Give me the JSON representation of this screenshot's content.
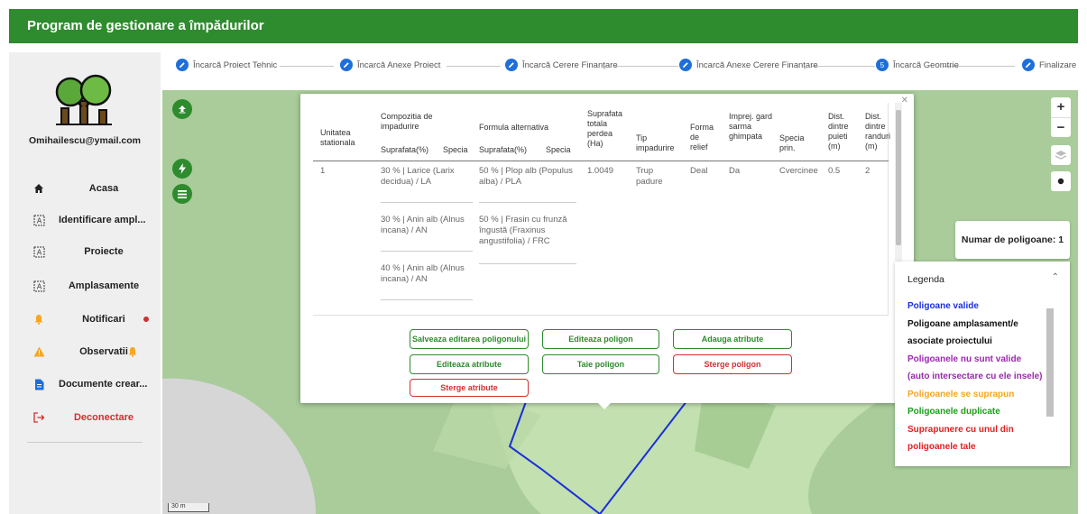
{
  "app": {
    "title": "Program de gestionare a împădurilor"
  },
  "colors": {
    "brand": "#2e8b2e",
    "step_dot": "#1e6fd9",
    "danger": "#d32f2f",
    "polygon_line": "#1a2fd8"
  },
  "sidebar": {
    "email": "Omihailescu@ymail.com",
    "items": [
      {
        "label": "Acasa",
        "icon": "home-icon"
      },
      {
        "label": "Identificare ampl...",
        "icon": "map-select-icon"
      },
      {
        "label": "Proiecte",
        "icon": "map-select-icon"
      },
      {
        "label": "Amplasamente",
        "icon": "map-select-icon"
      },
      {
        "label": "Notificari",
        "icon": "bell-icon"
      },
      {
        "label": "Observatii",
        "icon": "warning-icon"
      },
      {
        "label": "Documente crear...",
        "icon": "document-icon"
      },
      {
        "label": "Deconectare",
        "icon": "logout-icon"
      }
    ]
  },
  "stepper": {
    "steps": [
      {
        "label": "Încarcă Proiect Tehnic",
        "marker": ""
      },
      {
        "label": "Încarcă Anexe Proiect",
        "marker": ""
      },
      {
        "label": "Încarcă Cerere Finanțare",
        "marker": ""
      },
      {
        "label": "Încarcă Anexe Cerere Finanțare",
        "marker": ""
      },
      {
        "label": "Încarcă Geomtrie",
        "marker": "5"
      },
      {
        "label": "Finalizare",
        "marker": ""
      }
    ]
  },
  "table": {
    "headers": {
      "unitatea": "Unitatea stationala",
      "compozitia": "Compozitia de impadurire",
      "formula": "Formula alternativa",
      "suprafata_pct": "Suprafata(%)",
      "specia": "Specia",
      "suprafata_totala": "Suprafata totala perdea (Ha)",
      "tip": "Tip impadurire",
      "forma": "Forma de relief",
      "imprej": "Imprej. gard sarma ghimpata",
      "specia_prin": "Specia prin.",
      "dist_puieti": "Dist. dintre puieti (m)",
      "dist_randuri": "Dist. dintre randuri (m)"
    },
    "row": {
      "unitatea": "1",
      "compozitia": [
        "30 % | Larice (Larix decidua) / LA",
        "30 % | Anin alb (Alnus incana) / AN",
        "40 % | Anin alb (Alnus incana) / AN"
      ],
      "formula": [
        "50 % | Plop alb (Populus alba) / PLA",
        "50 % | Frasin cu frunză îngustă (Fraxinus angustifolia) / FRC"
      ],
      "suprafata_totala": "1.0049",
      "tip": "Trup padure",
      "forma": "Deal",
      "imprej": "Da",
      "specia_prin": "Cvercinee",
      "dist_puieti": "0.5",
      "dist_randuri": "2"
    }
  },
  "buttons": {
    "save_edit": "Salveaza editarea poligonului",
    "edit_polygon": "Editeaza poligon",
    "add_attribute": "Adauga atribute",
    "edit_attributes": "Editeaza atribute",
    "cut_polygon": "Taie poligon",
    "delete_polygon": "Sterge poligon",
    "delete_attributes": "Sterge atribute"
  },
  "map": {
    "polygon_count_label": "Numar de poligoane: 1",
    "scale_label": "30 m"
  },
  "legend": {
    "title": "Legenda",
    "items": [
      {
        "label": "Poligoane valide",
        "color": "#1a2fd8"
      },
      {
        "label": "Poligoane amplasament/e asociate proiectului",
        "color": "#111111"
      },
      {
        "label": "Poligoanele nu sunt valide (auto intersectare cu ele insele)",
        "color": "#9c27b0"
      },
      {
        "label": "Poligoanele se suprapun",
        "color": "#f5a623"
      },
      {
        "label": "Poligoanele duplicate",
        "color": "#1b9e1b"
      },
      {
        "label": "Suprapunere cu unul din poligoanele tale",
        "color": "#e02020"
      }
    ]
  }
}
